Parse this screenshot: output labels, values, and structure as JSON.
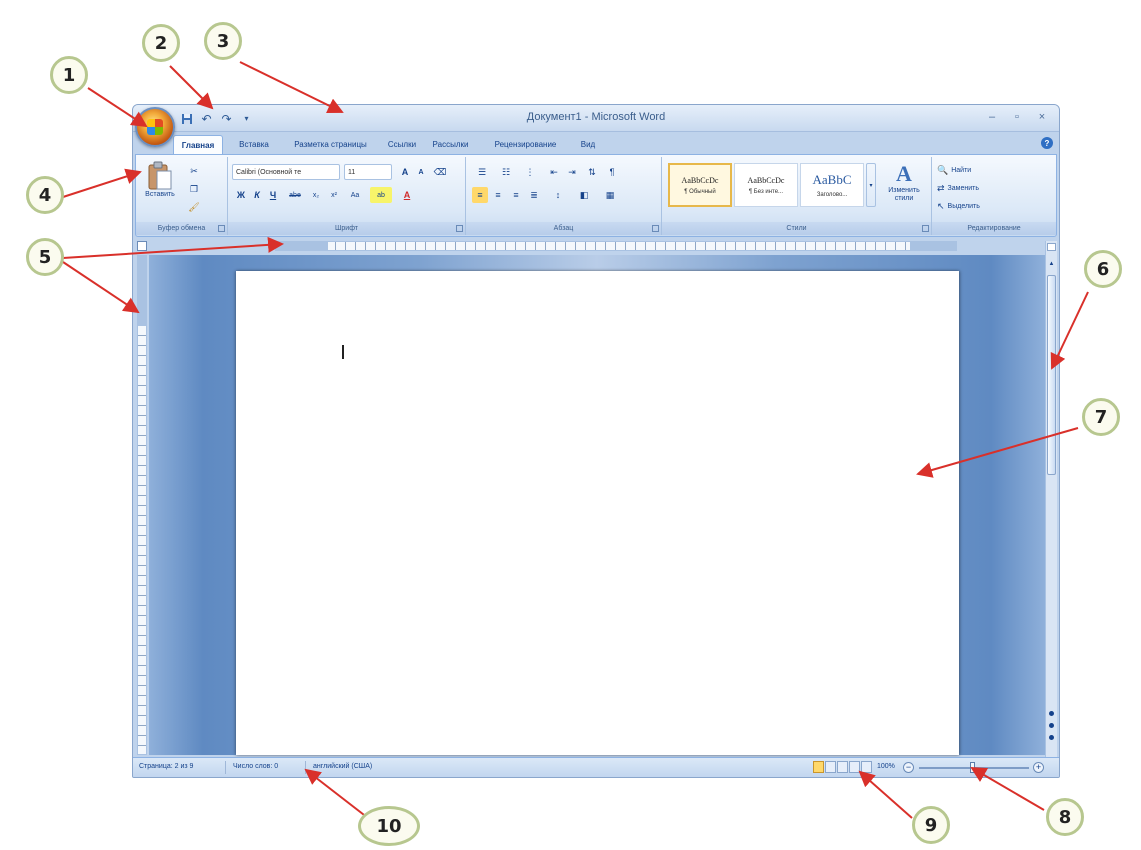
{
  "window": {
    "title": "Документ1 - Microsoft Word",
    "quick_access": [
      "save",
      "undo",
      "redo",
      "customize"
    ],
    "controls": {
      "minimize": "–",
      "maximize": "▫",
      "close": "×"
    }
  },
  "tabs": [
    "Главная",
    "Вставка",
    "Разметка страницы",
    "Ссылки",
    "Рассылки",
    "Рецензирование",
    "Вид"
  ],
  "ribbon": {
    "clipboard": {
      "paste_label": "Вставить",
      "group_label": "Буфер обмена"
    },
    "font": {
      "font_name": "Calibri (Основной те",
      "font_size": "11",
      "grow": "A",
      "shrink": "A",
      "bold": "Ж",
      "italic": "К",
      "underline": "Ч",
      "strike": "abe",
      "subscript": "x₂",
      "superscript": "x²",
      "case": "Aa",
      "highlight": "ab",
      "color": "A",
      "group_label": "Шрифт"
    },
    "paragraph": {
      "group_label": "Абзац",
      "pilcrow": "¶"
    },
    "styles": {
      "tiles": [
        {
          "sample": "AaBbCcDc",
          "name": "¶ Обычный"
        },
        {
          "sample": "AaBbCcDc",
          "name": "¶ Без инте..."
        },
        {
          "sample": "AaBbC",
          "name": "Заголово..."
        }
      ],
      "change_styles": "Изменить стили",
      "group_label": "Стили"
    },
    "editing": {
      "find": "Найти",
      "replace": "Заменить",
      "select": "Выделить",
      "group_label": "Редактирование"
    }
  },
  "statusbar": {
    "page": "Страница: 2 из 9",
    "words": "Число слов: 0",
    "language": "английский (США)",
    "zoom": "100%",
    "zoom_minus": "−",
    "zoom_plus": "+"
  },
  "callouts": [
    "1",
    "2",
    "3",
    "4",
    "5",
    "6",
    "7",
    "8",
    "9",
    "10"
  ],
  "colors": {
    "callout_border": "#b7c78f",
    "arrow": "#d9302a",
    "ribbon": "#dbe8f7",
    "doc_background": "#5f8ac2"
  }
}
